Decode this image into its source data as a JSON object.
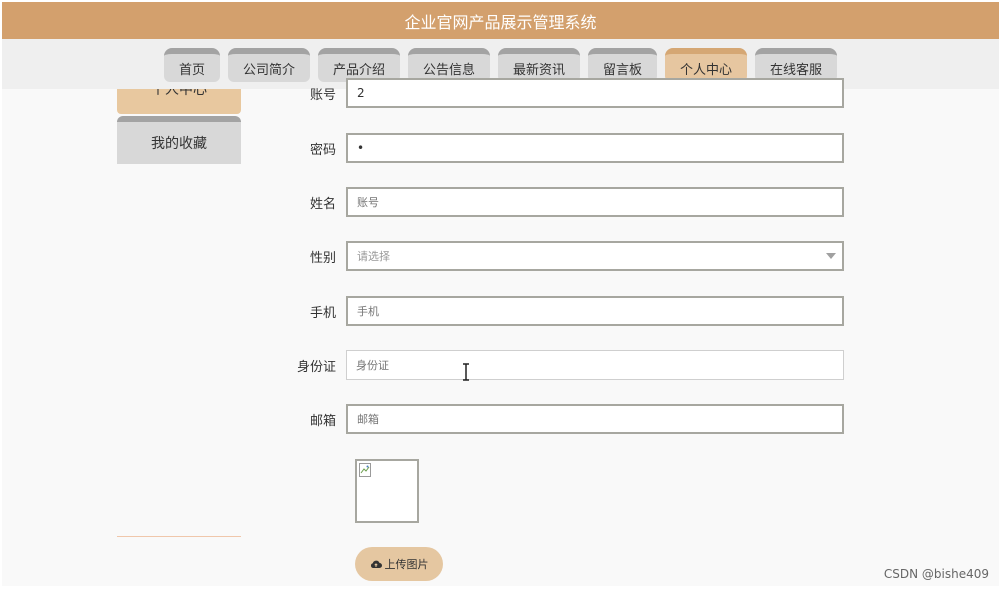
{
  "app": {
    "title": "企业官网产品展示管理系统"
  },
  "nav": {
    "items": [
      {
        "label": "首页"
      },
      {
        "label": "公司简介"
      },
      {
        "label": "产品介绍"
      },
      {
        "label": "公告信息"
      },
      {
        "label": "最新资讯"
      },
      {
        "label": "留言板"
      },
      {
        "label": "个人中心"
      },
      {
        "label": "在线客服"
      }
    ],
    "active": "个人中心"
  },
  "sidebar": {
    "items": [
      {
        "label": "个人中心"
      },
      {
        "label": "我的收藏"
      }
    ]
  },
  "form": {
    "account": {
      "label": "账号",
      "value": "2"
    },
    "password": {
      "label": "密码",
      "value": "•"
    },
    "name": {
      "label": "姓名",
      "placeholder": "账号"
    },
    "gender": {
      "label": "性别",
      "placeholder": "请选择"
    },
    "phone": {
      "label": "手机",
      "placeholder": "手机"
    },
    "id_card": {
      "label": "身份证",
      "placeholder": "身份证"
    },
    "email": {
      "label": "邮箱",
      "placeholder": "邮箱"
    }
  },
  "upload": {
    "label": "上传图片"
  },
  "watermark": "CSDN @bishe409",
  "colors": {
    "accent": "#d3a06d",
    "active_tab": "#e6c6a0",
    "tab": "#d8d8d8"
  }
}
